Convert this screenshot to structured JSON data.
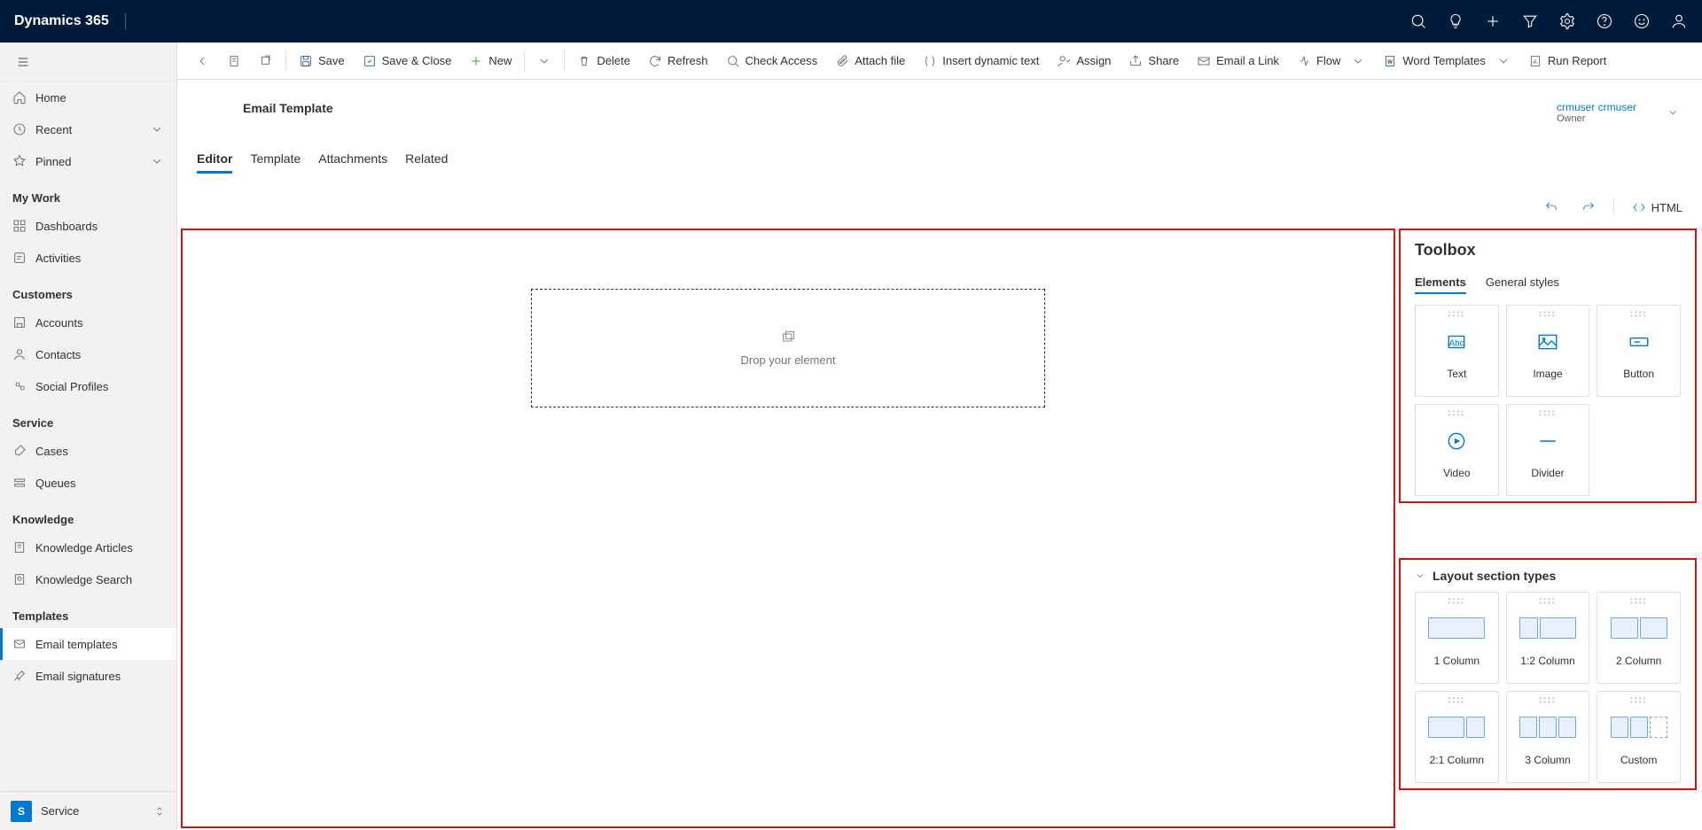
{
  "brand": "Dynamics 365",
  "sidebar": {
    "home": "Home",
    "recent": "Recent",
    "pinned": "Pinned",
    "sections": {
      "mywork": {
        "label": "My Work",
        "dashboards": "Dashboards",
        "activities": "Activities"
      },
      "customers": {
        "label": "Customers",
        "accounts": "Accounts",
        "contacts": "Contacts",
        "social": "Social Profiles"
      },
      "service": {
        "label": "Service",
        "cases": "Cases",
        "queues": "Queues"
      },
      "knowledge": {
        "label": "Knowledge",
        "articles": "Knowledge Articles",
        "search": "Knowledge Search"
      },
      "templates": {
        "label": "Templates",
        "email": "Email templates",
        "sign": "Email signatures"
      }
    },
    "switch": {
      "initial": "S",
      "label": "Service"
    }
  },
  "commands": {
    "save": "Save",
    "saveclose": "Save & Close",
    "new": "New",
    "delete": "Delete",
    "refresh": "Refresh",
    "checkaccess": "Check Access",
    "attach": "Attach file",
    "insertdyn": "Insert dynamic text",
    "assign": "Assign",
    "share": "Share",
    "emaillink": "Email a Link",
    "flow": "Flow",
    "wordtpl": "Word Templates",
    "runreport": "Run Report"
  },
  "pageHeader": {
    "title": "Email Template",
    "ownerName": "crmuser crmuser",
    "ownerLabel": "Owner"
  },
  "recordTabs": [
    "Editor",
    "Template",
    "Attachments",
    "Related"
  ],
  "editorActions": {
    "html": "HTML"
  },
  "canvas": {
    "drop": "Drop your element"
  },
  "toolbox": {
    "title": "Toolbox",
    "tabs": [
      "Elements",
      "General styles"
    ],
    "tiles": [
      "Text",
      "Image",
      "Button",
      "Video",
      "Divider"
    ]
  },
  "layouts": {
    "title": "Layout section types",
    "tiles": [
      "1 Column",
      "1:2 Column",
      "2 Column",
      "2:1 Column",
      "3 Column",
      "Custom"
    ]
  }
}
